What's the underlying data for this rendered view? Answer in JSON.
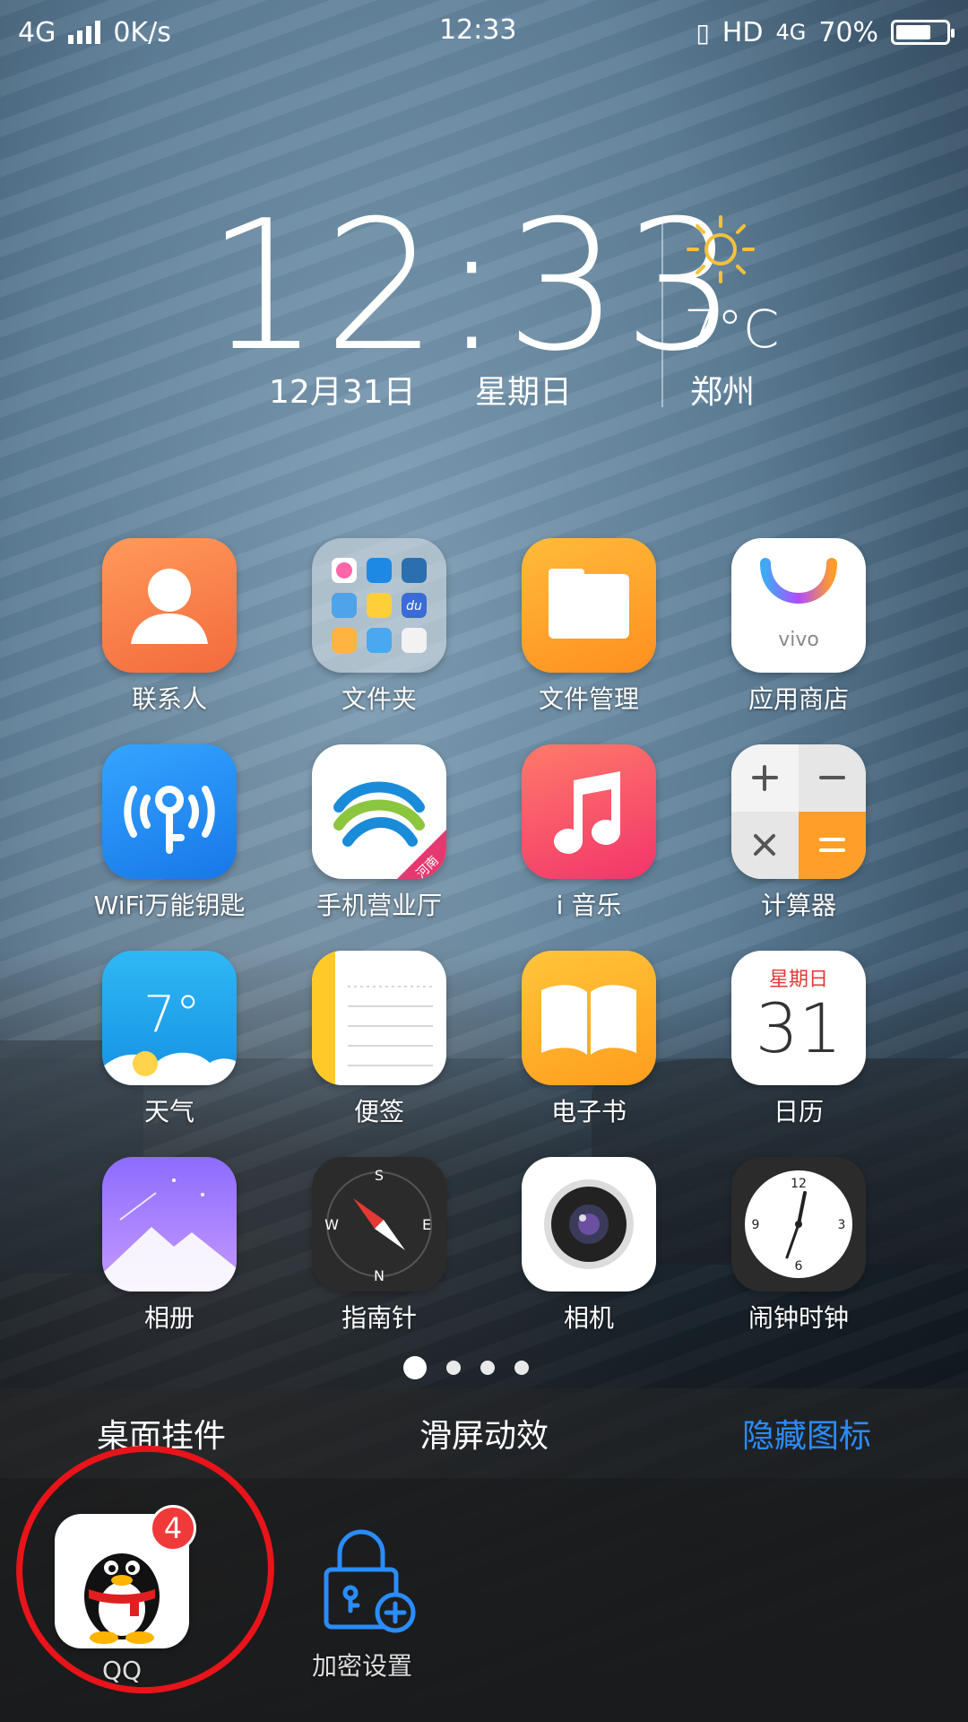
{
  "status_bar": {
    "network": "4G",
    "speed": "0K/s",
    "time": "12:33",
    "hd": "HD",
    "network_right": "4G",
    "battery": "70%",
    "battery_level": 0.7
  },
  "clock_widget": {
    "time": "12:33",
    "date": "12月31日",
    "weekday": "星期日",
    "temperature": "7°C",
    "city": "郑州",
    "weather_icon": "sun-icon"
  },
  "apps": [
    {
      "label": "联系人",
      "icon": "contacts-icon"
    },
    {
      "label": "文件夹",
      "icon": "folder-icon"
    },
    {
      "label": "文件管理",
      "icon": "file-manager-icon"
    },
    {
      "label": "应用商店",
      "icon": "app-store-icon",
      "icon_text": "vivo"
    },
    {
      "label": "WiFi万能钥匙",
      "icon": "wifi-key-icon"
    },
    {
      "label": "手机营业厅",
      "icon": "china-mobile-icon",
      "icon_text": "河南"
    },
    {
      "label": "i 音乐",
      "icon": "music-icon"
    },
    {
      "label": "计算器",
      "icon": "calculator-icon"
    },
    {
      "label": "天气",
      "icon": "weather-icon",
      "icon_text": "7°"
    },
    {
      "label": "便签",
      "icon": "notes-icon"
    },
    {
      "label": "电子书",
      "icon": "ebook-icon"
    },
    {
      "label": "日历",
      "icon": "calendar-icon",
      "icon_text": "星期日",
      "icon_number": "31"
    },
    {
      "label": "相册",
      "icon": "gallery-icon"
    },
    {
      "label": "指南针",
      "icon": "compass-icon"
    },
    {
      "label": "相机",
      "icon": "camera-icon"
    },
    {
      "label": "闹钟时钟",
      "icon": "clock-icon"
    }
  ],
  "folder_icon_text": "du",
  "compass_marks": {
    "n": "N",
    "s": "S",
    "e": "E",
    "w": "W"
  },
  "clock_marks": {
    "h12": "12",
    "h3": "3",
    "h6": "6",
    "h9": "9"
  },
  "page_indicator": {
    "pages": 4,
    "active": 1
  },
  "panel_tabs": [
    {
      "label": "桌面挂件"
    },
    {
      "label": "滑屏动效"
    },
    {
      "label": "隐藏图标",
      "selected": true
    }
  ],
  "tray": [
    {
      "label": "QQ",
      "icon": "qq-penguin-icon",
      "badge": "4"
    },
    {
      "label": "加密设置",
      "icon": "lock-plus-icon"
    }
  ],
  "colors": {
    "selected_tab": "#2a8cff",
    "badge": "#f03a3a",
    "annotation": "#e8141a"
  }
}
